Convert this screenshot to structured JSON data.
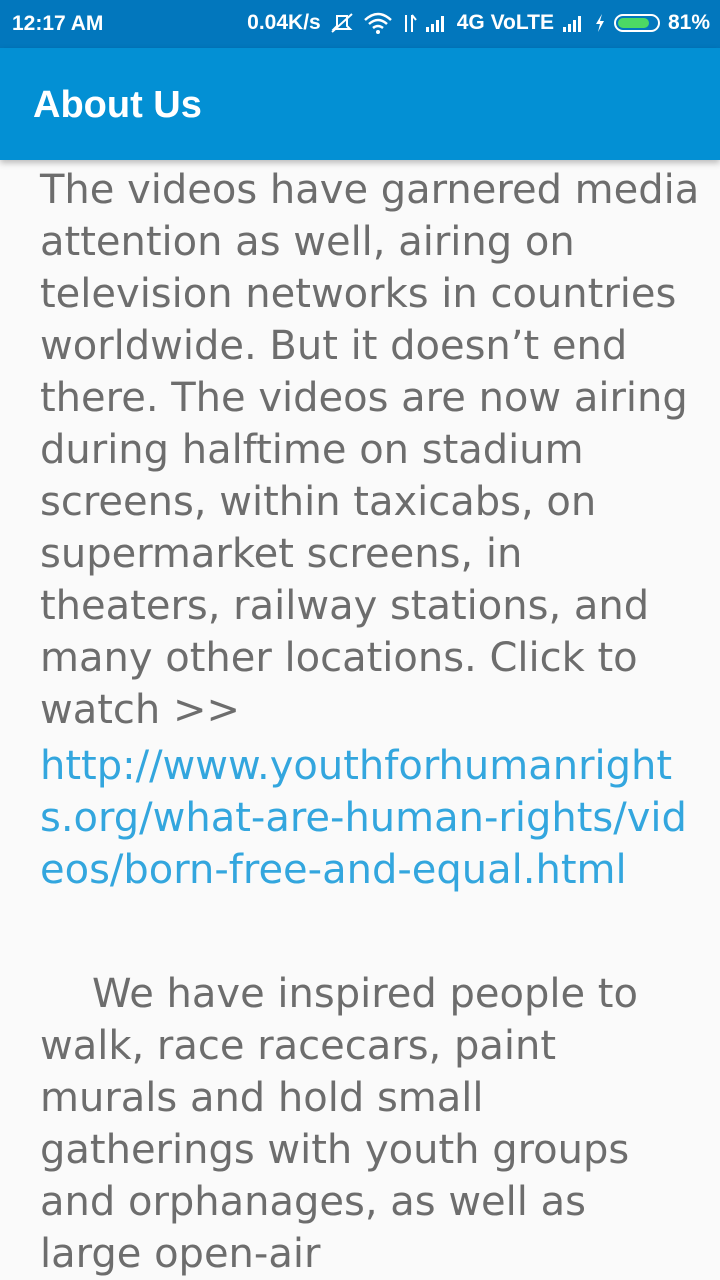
{
  "status_bar": {
    "time": "12:17 AM",
    "network_speed": "0.04K/s",
    "network_type": "4G VoLTE",
    "battery_percent": "81%",
    "battery_level": 0.81,
    "icons": [
      "mute-icon",
      "wifi-icon",
      "data-arrows-icon",
      "signal-icon",
      "signal-icon-2",
      "charging-icon",
      "battery-icon"
    ]
  },
  "app_bar": {
    "title": "About Us"
  },
  "content": {
    "paragraph1": "The videos have garnered media attention as well, airing on television networks in countries worldwide. But it doesn’t end there. The videos are now airing during halftime on stadium screens, within taxicabs, on supermarket screens, in theaters, railway stations, and many other locations. Click to watch >>",
    "link": "http://www.youthforhumanrights.org/what-are-human-rights/videos/born-free-and-equal.html",
    "paragraph2": "We have inspired people to walk, race racecars, paint murals and hold small gatherings with youth groups and orphanages, as well as large open-air"
  },
  "colors": {
    "status_bar": "#0277bd",
    "app_bar": "#0390d4",
    "body_text": "#6d6d6d",
    "link": "#33a6de",
    "background": "#fafafa"
  }
}
